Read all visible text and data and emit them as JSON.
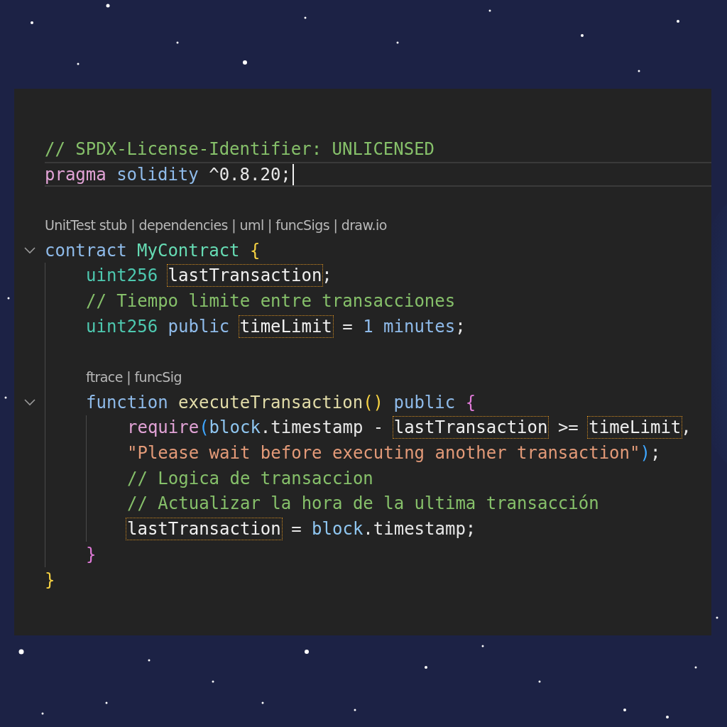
{
  "editor": {
    "lines": [
      {
        "kind": "code",
        "current": false,
        "tokens": [
          {
            "text": "// SPDX-License-Identifier: UNLICENSED",
            "kind": "comment"
          }
        ]
      },
      {
        "kind": "code",
        "current": true,
        "tokens": [
          {
            "text": "pragma ",
            "kind": "control"
          },
          {
            "text": "solidity",
            "kind": "keyword"
          },
          {
            "text": " ^0.8.20;",
            "kind": "plain"
          }
        ]
      },
      {
        "kind": "blank"
      },
      {
        "kind": "lens",
        "text": "UnitTest stub | dependencies | uml | funcSigs | draw.io"
      },
      {
        "kind": "code",
        "current": false,
        "expanded": true,
        "tokens": [
          {
            "text": "contract ",
            "kind": "keyword"
          },
          {
            "text": "MyContract ",
            "kind": "class"
          },
          {
            "text": "{",
            "kind": "bracket-gold"
          }
        ],
        "children": [
          {
            "kind": "code",
            "current": false,
            "tokens": [
              {
                "text": "uint256 ",
                "kind": "type"
              },
              {
                "text": "lastTransaction",
                "kind": "match"
              },
              {
                "text": ";",
                "kind": "plain"
              }
            ]
          },
          {
            "kind": "code",
            "current": false,
            "tokens": [
              {
                "text": "// Tiempo limite entre transacciones",
                "kind": "comment"
              }
            ]
          },
          {
            "kind": "code",
            "current": false,
            "tokens": [
              {
                "text": "uint256 ",
                "kind": "type"
              },
              {
                "text": "public ",
                "kind": "keyword"
              },
              {
                "text": "timeLimit",
                "kind": "match"
              },
              {
                "text": " = ",
                "kind": "plain"
              },
              {
                "text": "1 minutes",
                "kind": "number"
              },
              {
                "text": ";",
                "kind": "plain"
              }
            ]
          },
          {
            "kind": "blank"
          },
          {
            "kind": "lens",
            "text": "ftrace | funcSig"
          },
          {
            "kind": "code",
            "current": false,
            "expanded": true,
            "tokens": [
              {
                "text": "function ",
                "kind": "keyword"
              },
              {
                "text": "executeTransaction",
                "kind": "function"
              },
              {
                "text": "()",
                "kind": "bracket-gold"
              },
              {
                "text": " public ",
                "kind": "keyword"
              },
              {
                "text": "{",
                "kind": "bracket-pink"
              }
            ],
            "children": [
              {
                "kind": "code",
                "current": false,
                "tokens": [
                  {
                    "text": "require",
                    "kind": "control"
                  },
                  {
                    "text": "(",
                    "kind": "bracket-blue"
                  },
                  {
                    "text": "block",
                    "kind": "variable"
                  },
                  {
                    "text": ".timestamp - ",
                    "kind": "plain"
                  },
                  {
                    "text": "lastTransaction",
                    "kind": "match"
                  },
                  {
                    "text": " >= ",
                    "kind": "plain"
                  },
                  {
                    "text": "timeLimit",
                    "kind": "match"
                  },
                  {
                    "text": ",",
                    "kind": "plain"
                  }
                ]
              },
              {
                "kind": "code",
                "current": false,
                "tokens": [
                  {
                    "text": "\"Please wait before executing another transaction\"",
                    "kind": "string"
                  },
                  {
                    "text": ")",
                    "kind": "bracket-blue"
                  },
                  {
                    "text": ";",
                    "kind": "plain"
                  }
                ]
              },
              {
                "kind": "code",
                "current": false,
                "tokens": [
                  {
                    "text": "// Logica de transaccion",
                    "kind": "comment"
                  }
                ]
              },
              {
                "kind": "code",
                "current": false,
                "tokens": [
                  {
                    "text": "// Actualizar la hora de la ultima transacción",
                    "kind": "comment"
                  }
                ]
              },
              {
                "kind": "code",
                "current": false,
                "tokens": [
                  {
                    "text": "lastTransaction",
                    "kind": "match"
                  },
                  {
                    "text": " = ",
                    "kind": "plain"
                  },
                  {
                    "text": "block",
                    "kind": "variable"
                  },
                  {
                    "text": ".timestamp;",
                    "kind": "plain"
                  }
                ]
              }
            ]
          },
          {
            "kind": "code",
            "current": false,
            "tokens": [
              {
                "text": "}",
                "kind": "bracket-pink"
              }
            ]
          }
        ]
      },
      {
        "kind": "code",
        "current": false,
        "tokens": [
          {
            "text": "}",
            "kind": "bracket-gold"
          }
        ]
      }
    ]
  }
}
